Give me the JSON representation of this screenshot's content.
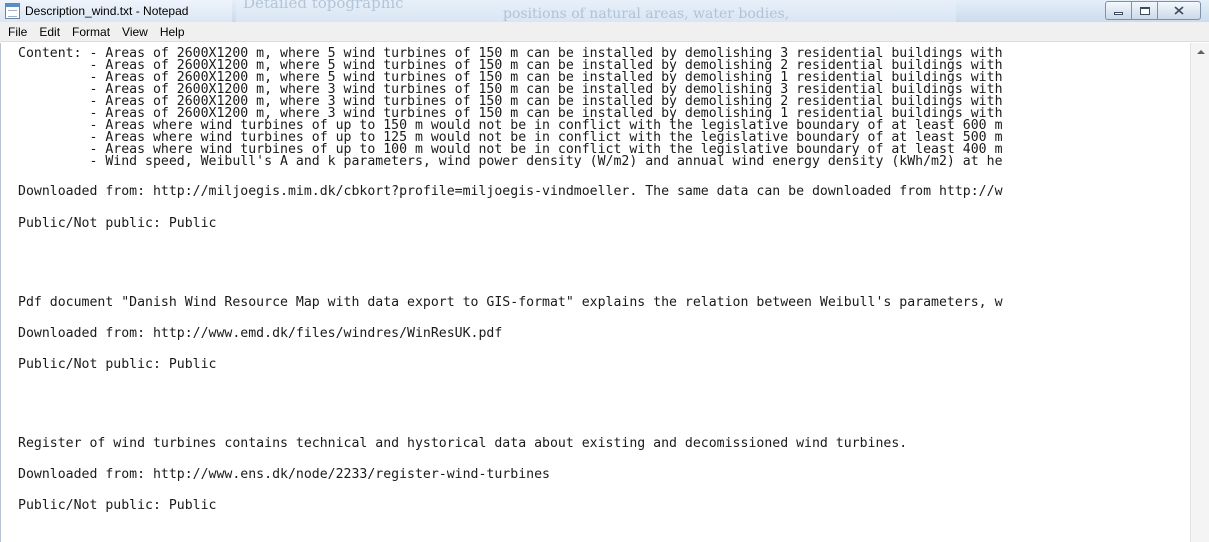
{
  "window": {
    "title": "Description_wind.txt - Notepad",
    "background_text": [
      "Detailed topographic",
      "positions of natural areas, water bodies,"
    ]
  },
  "menu": [
    "File",
    "Edit",
    "Format",
    "View",
    "Help"
  ],
  "editor": {
    "lines": [
      "Content: - Areas of 2600X1200 m, where 5 wind turbines of 150 m can be installed by demolishing 3 residential buildings with",
      "         - Areas of 2600X1200 m, where 5 wind turbines of 150 m can be installed by demolishing 2 residential buildings with",
      "         - Areas of 2600X1200 m, where 5 wind turbines of 150 m can be installed by demolishing 1 residential buildings with",
      "         - Areas of 2600X1200 m, where 3 wind turbines of 150 m can be installed by demolishing 3 residential buildings with",
      "         - Areas of 2600X1200 m, where 3 wind turbines of 150 m can be installed by demolishing 2 residential buildings with",
      "         - Areas of 2600X1200 m, where 3 wind turbines of 150 m can be installed by demolishing 1 residential buildings with",
      "         - Areas where wind turbines of up to 150 m would not be in conflict with the legislative boundary of at least 600 m",
      "         - Areas where wind turbines of up to 125 m would not be in conflict with the legislative boundary of at least 500 m",
      "         - Areas where wind turbines of up to 100 m would not be in conflict with the legislative boundary of at least 400 m",
      "         - Wind speed, Weibull's A and k parameters, wind power density (W/m2) and annual wind energy density (kWh/m2) at he",
      "Downloaded from: http://miljoegis.mim.dk/cbkort?profile=miljoegis-vindmoeller. The same data can be downloaded from http://w",
      "Public/Not public: Public",
      "Pdf document \"Danish Wind Resource Map with data export to GIS-format\" explains the relation between Weibull's parameters, w",
      "Downloaded from: http://www.emd.dk/files/windres/WinResUK.pdf",
      "Public/Not public: Public",
      "Register of wind turbines contains technical and hystorical data about existing and decomissioned wind turbines.",
      "Downloaded from: http://www.ens.dk/node/2233/register-wind-turbines",
      "Public/Not public: Public"
    ]
  }
}
